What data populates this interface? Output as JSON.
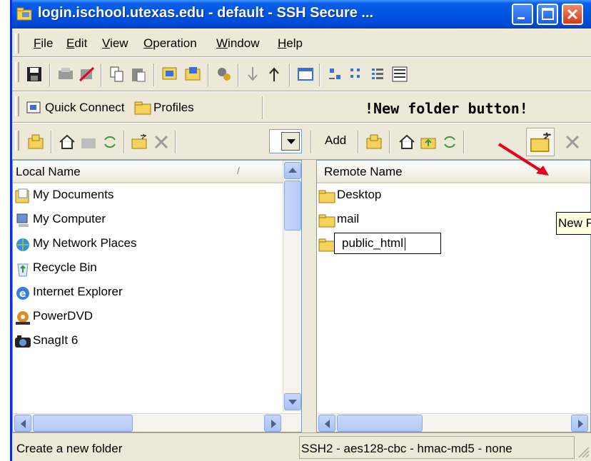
{
  "window": {
    "title": "login.ischool.utexas.edu - default - SSH Secure ..."
  },
  "menu": {
    "items": [
      {
        "label": "File",
        "u": "F",
        "rest": "ile"
      },
      {
        "label": "Edit",
        "u": "E",
        "rest": "dit"
      },
      {
        "label": "View",
        "u": "V",
        "rest": "iew"
      },
      {
        "label": "Operation",
        "u": "O",
        "rest": "peration"
      },
      {
        "label": "Window",
        "u": "W",
        "rest": "indow"
      },
      {
        "label": "Help",
        "u": "H",
        "rest": "elp"
      }
    ]
  },
  "connectbar": {
    "quick_connect": "Quick Connect",
    "profiles": "Profiles",
    "annotation": "!New folder button!"
  },
  "filebar": {
    "add_label": "Add"
  },
  "local": {
    "column": "Local Name",
    "sort_mark": "/",
    "items": [
      "My Documents",
      "My Computer",
      "My Network Places",
      "Recycle Bin",
      "Internet Explorer",
      "PowerDVD",
      "SnagIt 6"
    ]
  },
  "remote": {
    "column": "Remote Name",
    "sort_mark": "/",
    "items": [
      "Desktop",
      "mail"
    ],
    "rename_value": "public_html"
  },
  "tooltip": "New F",
  "status": {
    "message": "Create a new folder",
    "encryption": "SSH2 - aes128-cbc - hmac-md5 - none"
  },
  "colors": {
    "titlebar": "#0053e1",
    "face": "#ece9d8",
    "annotation_arrow": "#e8001c",
    "folder": "#f5d35a"
  }
}
